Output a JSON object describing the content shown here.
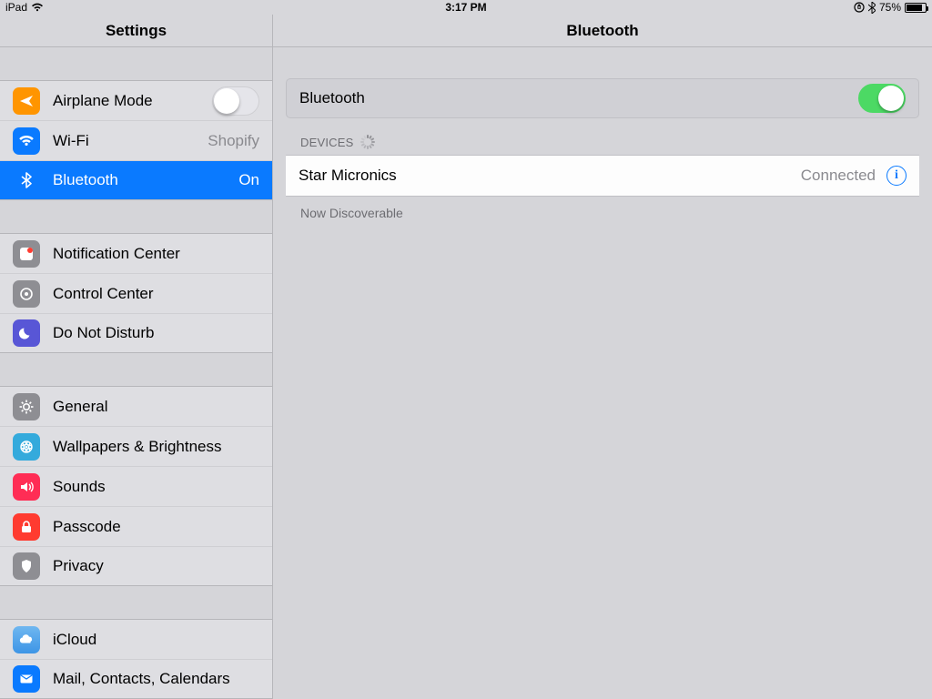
{
  "status": {
    "device": "iPad",
    "time": "3:17 PM",
    "battery_pct": "75%"
  },
  "header": {
    "left_title": "Settings",
    "right_title": "Bluetooth"
  },
  "sidebar": {
    "group1": [
      {
        "icon": "airplane-icon",
        "label": "Airplane Mode",
        "toggle": false
      },
      {
        "icon": "wifi-icon",
        "label": "Wi-Fi",
        "detail": "Shopify"
      },
      {
        "icon": "bluetooth-icon",
        "label": "Bluetooth",
        "detail": "On",
        "selected": true
      }
    ],
    "group2": [
      {
        "icon": "notification-icon",
        "label": "Notification Center"
      },
      {
        "icon": "control-center-icon",
        "label": "Control Center"
      },
      {
        "icon": "dnd-icon",
        "label": "Do Not Disturb"
      }
    ],
    "group3": [
      {
        "icon": "general-icon",
        "label": "General"
      },
      {
        "icon": "wallpapers-icon",
        "label": "Wallpapers & Brightness"
      },
      {
        "icon": "sounds-icon",
        "label": "Sounds"
      },
      {
        "icon": "passcode-icon",
        "label": "Passcode"
      },
      {
        "icon": "privacy-icon",
        "label": "Privacy"
      }
    ],
    "group4": [
      {
        "icon": "icloud-icon",
        "label": "iCloud"
      },
      {
        "icon": "mail-icon",
        "label": "Mail, Contacts, Calendars"
      }
    ]
  },
  "detail": {
    "master_label": "Bluetooth",
    "master_on": true,
    "section_header": "DEVICES",
    "devices": [
      {
        "name": "Star Micronics",
        "status": "Connected"
      }
    ],
    "footer": "Now Discoverable"
  }
}
